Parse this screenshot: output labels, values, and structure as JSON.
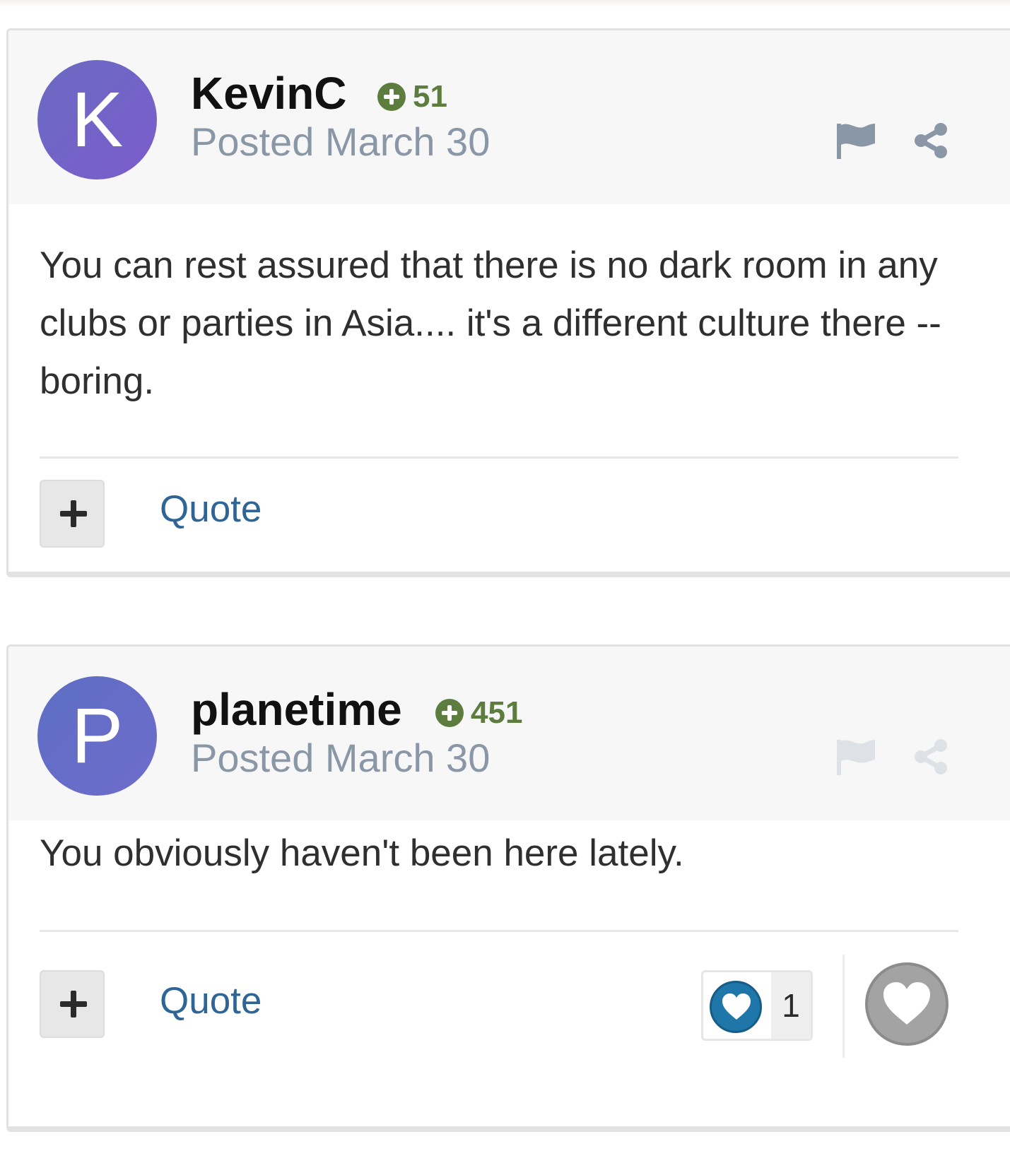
{
  "posts": [
    {
      "avatar_letter": "K",
      "username": "KevinC",
      "reputation": "51",
      "posted": "Posted March 30",
      "content": "You can rest assured that there is no dark room in any clubs or parties in Asia.... it's a different culture there -- boring.",
      "quote_label": "Quote",
      "actions_faded": false
    },
    {
      "avatar_letter": "P",
      "username": "planetime",
      "reputation": "451",
      "posted": "Posted March 30",
      "content": "You obviously haven't been here lately.",
      "quote_label": "Quote",
      "like_count": "1",
      "actions_faded": true
    }
  ],
  "colors": {
    "avatar_k": "#7462c8",
    "avatar_p": "#6370c6",
    "reputation_green": "#5d7d3f",
    "link_blue": "#2f6496",
    "posted_gray": "#8a97a7",
    "like_blue": "#1f76a8"
  },
  "icons": {
    "reputation": "plus-circle-icon",
    "report": "flag-icon",
    "share": "share-icon",
    "add": "plus-icon",
    "like": "heart-icon"
  }
}
